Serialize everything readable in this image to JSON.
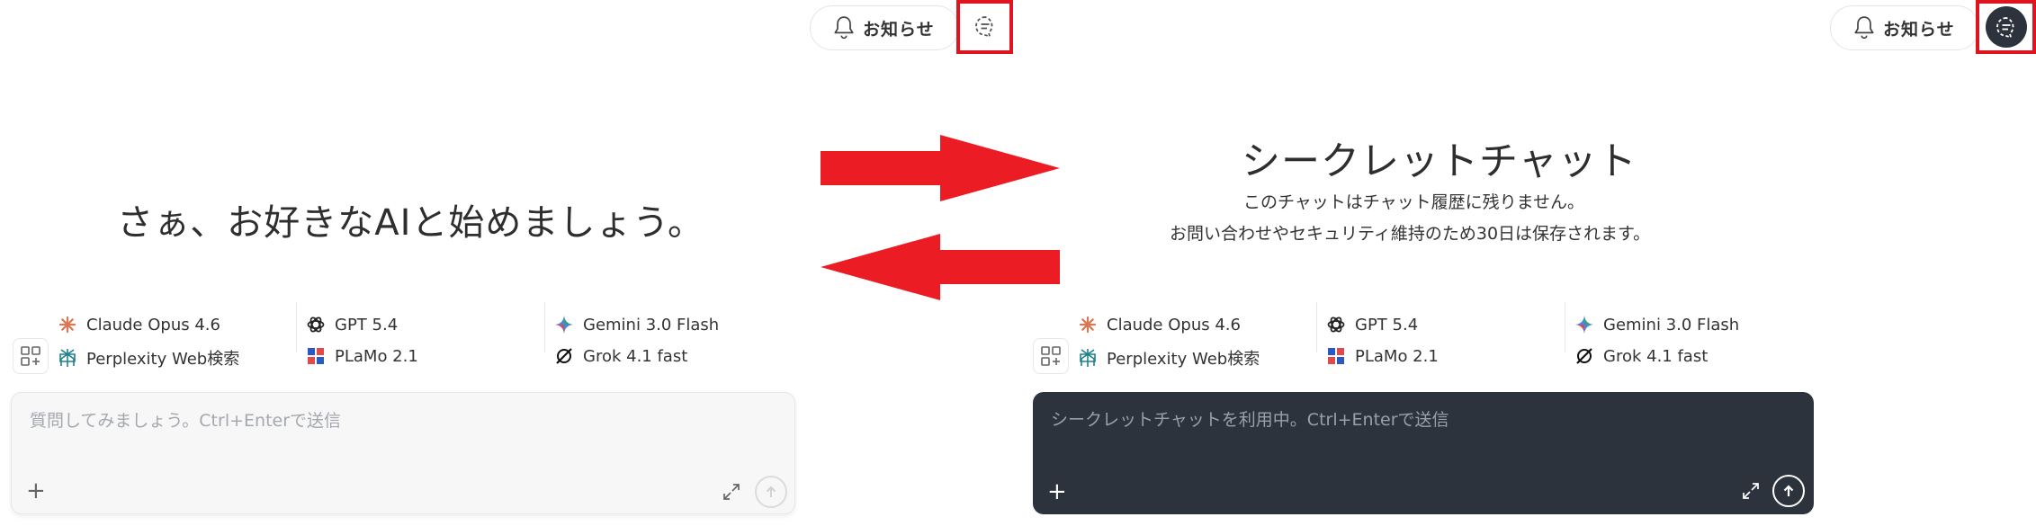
{
  "left_panel": {
    "notifications_label": "お知らせ",
    "headline": "さぁ、お好きなAIと始めましょう。",
    "models": [
      {
        "label": "Claude Opus 4.6",
        "icon": "claude-icon"
      },
      {
        "label": "GPT 5.4",
        "icon": "openai-icon"
      },
      {
        "label": "Gemini 3.0 Flash",
        "icon": "gemini-icon"
      },
      {
        "label": "Perplexity Web検索",
        "icon": "perplexity-icon"
      },
      {
        "label": "PLaMo 2.1",
        "icon": "plamo-icon"
      },
      {
        "label": "Grok 4.1 fast",
        "icon": "grok-icon"
      }
    ],
    "input_placeholder": "質問してみましょう。Ctrl+Enterで送信",
    "plus_label": "+"
  },
  "right_panel": {
    "notifications_label": "お知らせ",
    "title": "シークレットチャット",
    "subtitle_line1": "このチャットはチャット履歴に残りません。",
    "subtitle_line2": "お問い合わせやセキュリティ維持のため30日は保存されます。",
    "models": [
      {
        "label": "Claude Opus 4.6",
        "icon": "claude-icon"
      },
      {
        "label": "GPT 5.4",
        "icon": "openai-icon"
      },
      {
        "label": "Gemini 3.0 Flash",
        "icon": "gemini-icon"
      },
      {
        "label": "Perplexity Web検索",
        "icon": "perplexity-icon"
      },
      {
        "label": "PLaMo 2.1",
        "icon": "plamo-icon"
      },
      {
        "label": "Grok 4.1 fast",
        "icon": "grok-icon"
      }
    ],
    "input_placeholder": "シークレットチャットを利用中。Ctrl+Enterで送信",
    "plus_label": "+"
  },
  "colors": {
    "highlight": "#e0141e",
    "arrow": "#ec1c24",
    "secret_dark": "#2d333d",
    "claude": "#d97757",
    "perplexity": "#20808d",
    "plamo": "#2b59c3"
  }
}
